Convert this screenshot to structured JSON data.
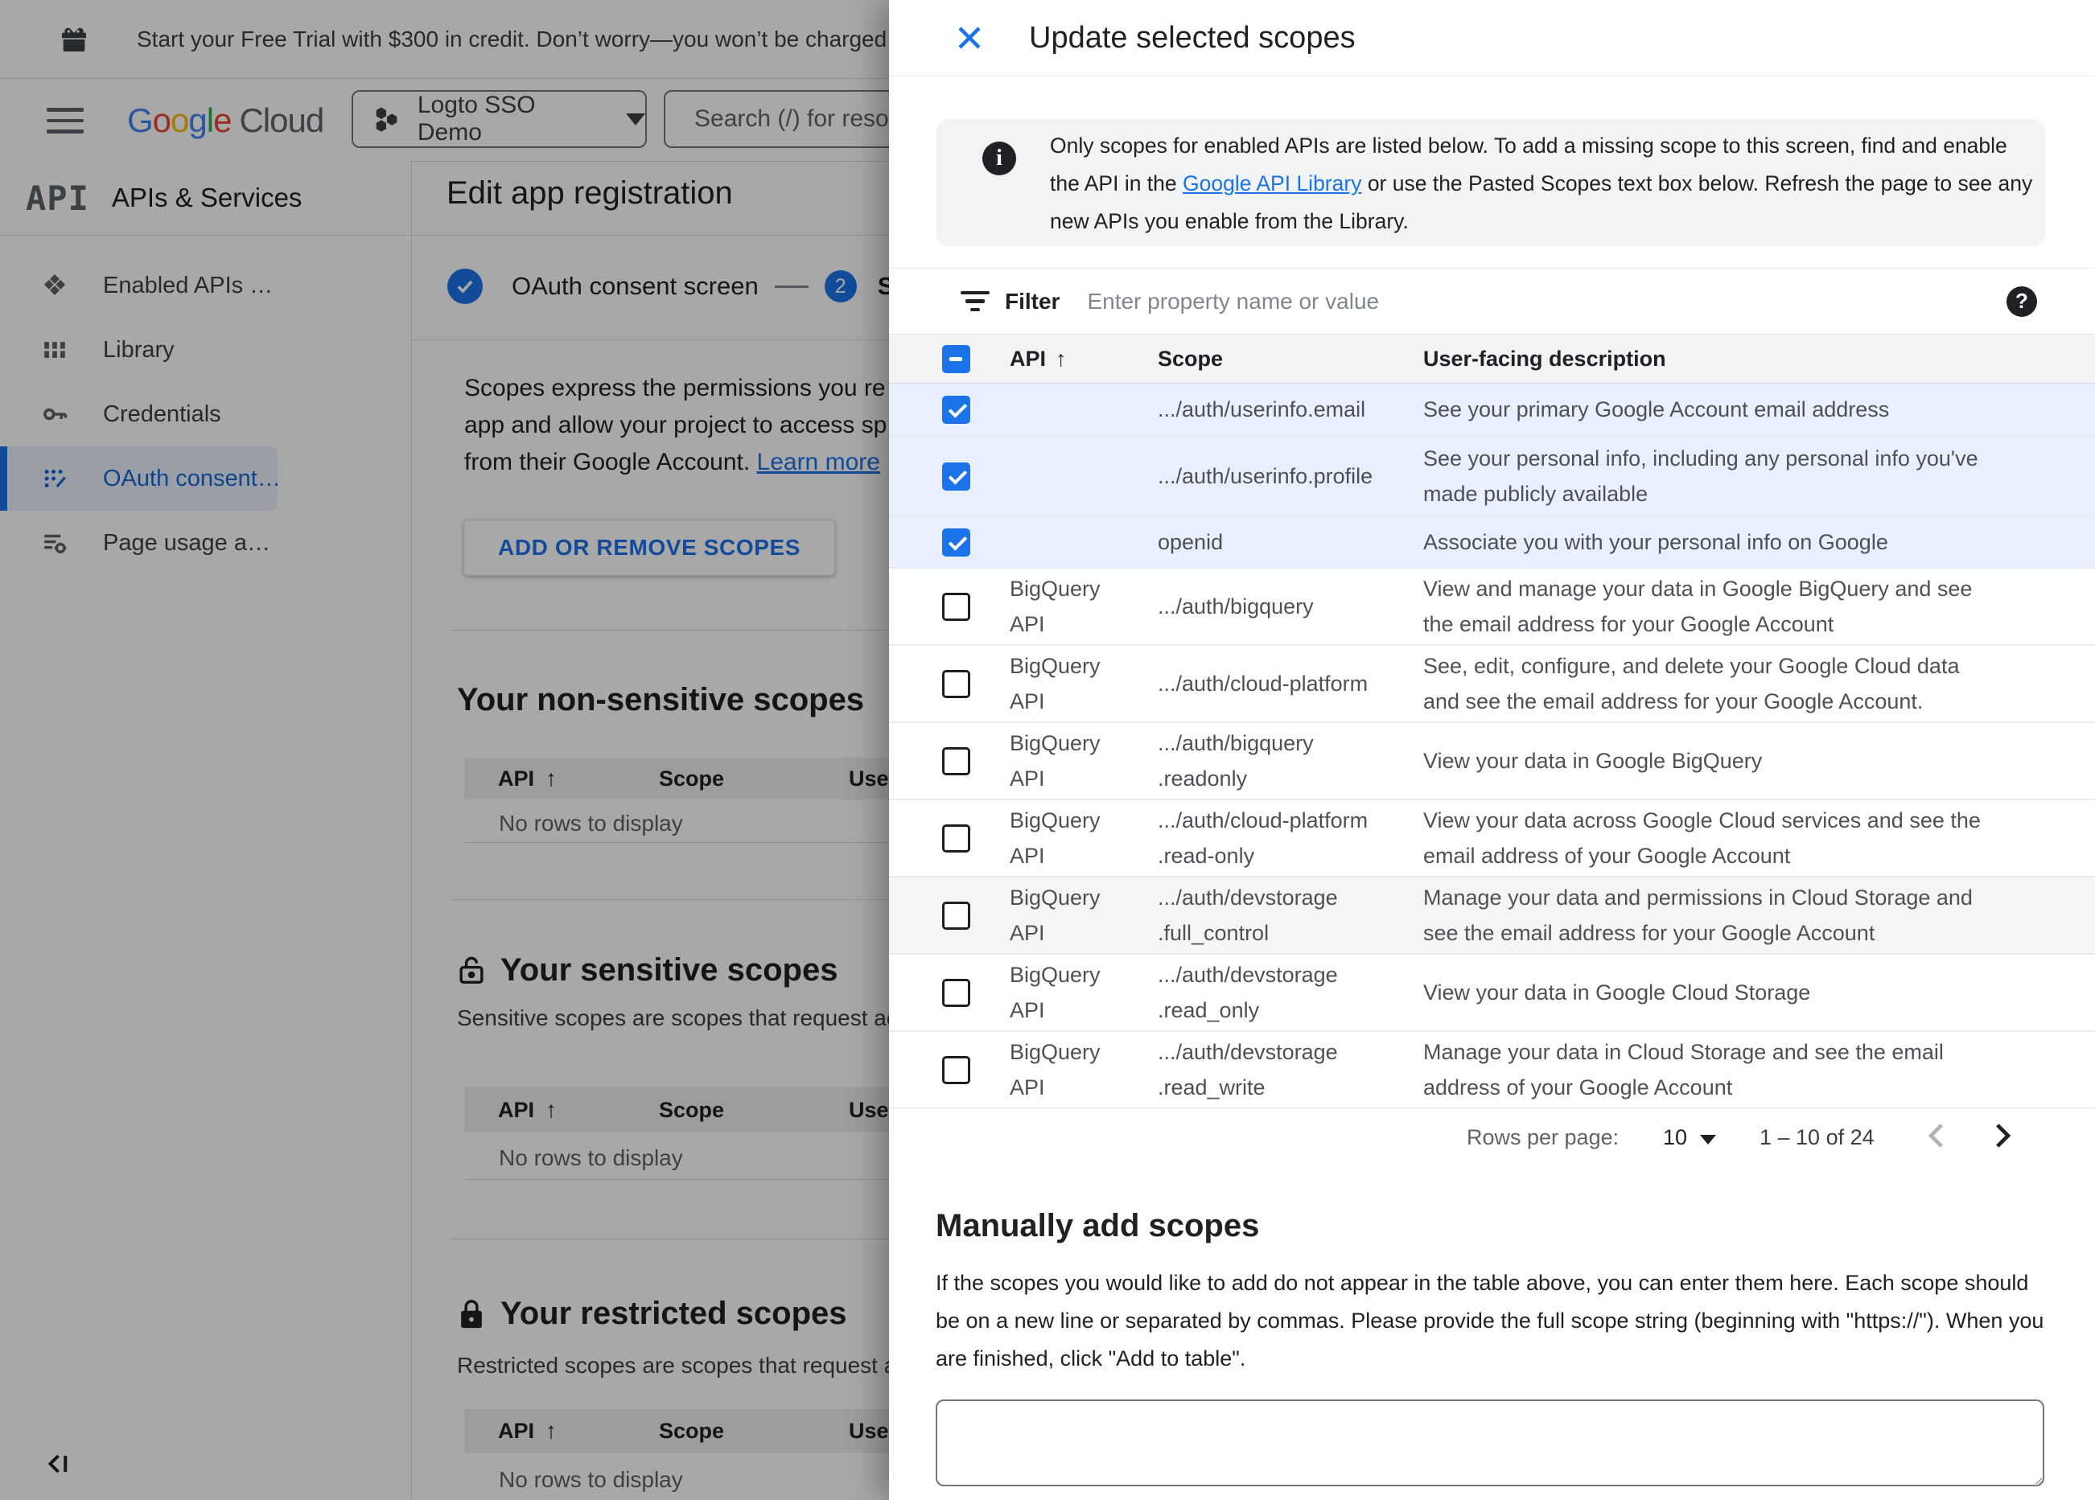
{
  "colors": {
    "accent_blue": "#1a73e8",
    "active_link_blue": "#1967d2",
    "selected_row_bg": "#e8f0fe",
    "scrim": "rgba(0,0,0,0.34)",
    "info_box_bg": "#f1f3f4"
  },
  "banner": {
    "text": "Start your Free Trial with $300 in credit. Don’t worry—you won’t be charged if you run out of c"
  },
  "topbar": {
    "logo_letters": [
      "G",
      "o",
      "o",
      "g",
      "l",
      "e"
    ],
    "logo_cloud": "Cloud",
    "project_name": "Logto SSO Demo",
    "search_placeholder": "Search (/) for resou"
  },
  "sidebar": {
    "product_glyph": "API",
    "product_title": "APIs & Services",
    "items": [
      {
        "label": "Enabled APIs …",
        "active": false
      },
      {
        "label": "Library",
        "active": false
      },
      {
        "label": "Credentials",
        "active": false
      },
      {
        "label": "OAuth consent…",
        "active": true
      },
      {
        "label": "Page usage a…",
        "active": false
      }
    ]
  },
  "main": {
    "title": "Edit app registration",
    "step1_label": "OAuth consent screen",
    "step2_number": "2",
    "step2_label": "Scopes",
    "intro_line1": "Scopes express the permissions you re",
    "intro_line2": "app and allow your project to access sp",
    "intro_line3": "from their Google Account. ",
    "learn_more": "Learn more",
    "add_scopes_button": "ADD OR REMOVE SCOPES",
    "sections": [
      {
        "heading": "Your non-sensitive scopes",
        "description": "",
        "col_api": "API",
        "sort_arrow": "↑",
        "col_scope": "Scope",
        "col_user": "User-facing description",
        "empty": "No rows to display"
      },
      {
        "heading": "Your sensitive scopes",
        "description": "Sensitive scopes are scopes that request acc",
        "col_api": "API",
        "sort_arrow": "↑",
        "col_scope": "Scope",
        "col_user": "User-facing description",
        "empty": "No rows to display"
      },
      {
        "heading": "Your restricted scopes",
        "description": "Restricted scopes are scopes that request ac",
        "col_api": "API",
        "sort_arrow": "↑",
        "col_scope": "Scope",
        "col_user": "User-facing description",
        "empty": "No rows to display"
      }
    ]
  },
  "panel": {
    "title": "Update selected scopes",
    "info": {
      "line1": "Only scopes for enabled APIs are listed below. To add a missing scope to this screen, find and enable",
      "line2_pre": "the API in the ",
      "line2_link": "Google API Library",
      "line2_post": " or use the Pasted Scopes text box below. Refresh the page to see any",
      "line3": "new APIs you enable from the Library."
    },
    "filter": {
      "label": "Filter",
      "placeholder": "Enter property name or value"
    },
    "table": {
      "col_api": "API",
      "sort_arrow": "↑",
      "col_scope": "Scope",
      "col_desc": "User-facing description",
      "rows": [
        {
          "checked": true,
          "api": "",
          "scope": ".../auth/userinfo.email",
          "desc": "See your primary Google Account email address"
        },
        {
          "checked": true,
          "api": "",
          "scope": ".../auth/userinfo.profile",
          "desc": "See your personal info, including any personal info you've made publicly available"
        },
        {
          "checked": true,
          "api": "",
          "scope": "openid",
          "desc": "Associate you with your personal info on Google"
        },
        {
          "checked": false,
          "api": "BigQuery\nAPI",
          "scope": ".../auth/bigquery",
          "desc": "View and manage your data in Google BigQuery and see the email address for your Google Account"
        },
        {
          "checked": false,
          "api": "BigQuery\nAPI",
          "scope": ".../auth/cloud-platform",
          "desc": "See, edit, configure, and delete your Google Cloud data and see the email address for your Google Account."
        },
        {
          "checked": false,
          "api": "BigQuery\nAPI",
          "scope": ".../auth/bigquery\n.readonly",
          "desc": "View your data in Google BigQuery"
        },
        {
          "checked": false,
          "api": "BigQuery\nAPI",
          "scope": ".../auth/cloud-platform\n.read-only",
          "desc": "View your data across Google Cloud services and see the email address of your Google Account"
        },
        {
          "checked": false,
          "shaded": true,
          "api": "BigQuery\nAPI",
          "scope": ".../auth/devstorage\n.full_control",
          "desc": "Manage your data and permissions in Cloud Storage and see the email address for your Google Account"
        },
        {
          "checked": false,
          "api": "BigQuery\nAPI",
          "scope": ".../auth/devstorage\n.read_only",
          "desc": "View your data in Google Cloud Storage"
        },
        {
          "checked": false,
          "api": "BigQuery\nAPI",
          "scope": ".../auth/devstorage\n.read_write",
          "desc": "Manage your data in Cloud Storage and see the email address of your Google Account"
        }
      ]
    },
    "pagination": {
      "rows_per_page_label": "Rows per page:",
      "rows_per_page": "10",
      "range": "1 – 10 of 24"
    },
    "manual": {
      "heading": "Manually add scopes",
      "description": "If the scopes you would like to add do not appear in the table above, you can enter them here. Each scope should be on a new line or separated by commas. Please provide the full scope string (beginning with \"https://\"). When you are finished, click \"Add to table\".",
      "textarea_value": ""
    }
  }
}
